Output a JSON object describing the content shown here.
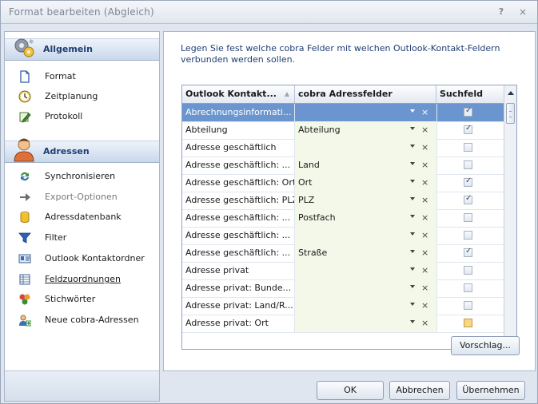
{
  "window": {
    "title": "Format bearbeiten (Abgleich)",
    "help_glyph": "?",
    "close_glyph": "×"
  },
  "sidebar": {
    "sections": [
      {
        "label": "Allgemein",
        "icon": "gears-icon",
        "items": [
          {
            "label": "Format",
            "icon": "document-icon",
            "state": "normal"
          },
          {
            "label": "Zeitplanung",
            "icon": "clock-icon",
            "state": "normal"
          },
          {
            "label": "Protokoll",
            "icon": "pencil-icon",
            "state": "normal"
          }
        ]
      },
      {
        "label": "Adressen",
        "icon": "person-icon",
        "items": [
          {
            "label": "Synchronisieren",
            "icon": "sync-icon",
            "state": "normal"
          },
          {
            "label": "Export-Optionen",
            "icon": "arrow-right-icon",
            "state": "disabled"
          },
          {
            "label": "Adressdatenbank",
            "icon": "database-icon",
            "state": "normal"
          },
          {
            "label": "Filter",
            "icon": "filter-icon",
            "state": "normal"
          },
          {
            "label": "Outlook Kontaktordner",
            "icon": "contact-card-icon",
            "state": "normal"
          },
          {
            "label": "Feldzuordnungen",
            "icon": "field-mapping-icon",
            "state": "active"
          },
          {
            "label": "Stichwörter",
            "icon": "keywords-icon",
            "state": "normal"
          },
          {
            "label": "Neue cobra-Adressen",
            "icon": "new-contacts-icon",
            "state": "normal"
          }
        ]
      }
    ]
  },
  "main": {
    "description": "Legen Sie fest welche cobra Felder mit welchen Outlook-Kontakt-Feldern verbunden werden sollen.",
    "columns": [
      "Outlook Kontakt...",
      "cobra Adressfelder",
      "Suchfeld"
    ],
    "sort_glyph": "▲",
    "remove_glyph": "×",
    "rows": [
      {
        "outlook": "Abrechnungsinformati...",
        "cobra": "",
        "search": true,
        "selected": true,
        "highlight": false
      },
      {
        "outlook": "Abteilung",
        "cobra": "Abteilung",
        "search": true,
        "selected": false,
        "highlight": false
      },
      {
        "outlook": "Adresse geschäftlich",
        "cobra": "",
        "search": false,
        "selected": false,
        "highlight": false
      },
      {
        "outlook": "Adresse geschäftlich: ...",
        "cobra": "Land",
        "search": false,
        "selected": false,
        "highlight": false
      },
      {
        "outlook": "Adresse geschäftlich: Ort",
        "cobra": "Ort",
        "search": true,
        "selected": false,
        "highlight": false
      },
      {
        "outlook": "Adresse geschäftlich: PLZ",
        "cobra": "PLZ",
        "search": true,
        "selected": false,
        "highlight": false
      },
      {
        "outlook": "Adresse geschäftlich: ...",
        "cobra": "Postfach",
        "search": false,
        "selected": false,
        "highlight": false
      },
      {
        "outlook": "Adresse geschäftlich: ...",
        "cobra": "",
        "search": false,
        "selected": false,
        "highlight": false
      },
      {
        "outlook": "Adresse geschäftlich: ...",
        "cobra": "Straße",
        "search": true,
        "selected": false,
        "highlight": false
      },
      {
        "outlook": "Adresse privat",
        "cobra": "",
        "search": false,
        "selected": false,
        "highlight": false
      },
      {
        "outlook": "Adresse privat: Bunde...",
        "cobra": "",
        "search": false,
        "selected": false,
        "highlight": false
      },
      {
        "outlook": "Adresse privat: Land/R...",
        "cobra": "",
        "search": false,
        "selected": false,
        "highlight": false
      },
      {
        "outlook": "Adresse privat: Ort",
        "cobra": "",
        "search": false,
        "selected": false,
        "highlight": true
      }
    ],
    "suggest_label": "Vorschlag..."
  },
  "footer": {
    "ok_label": "OK",
    "cancel_label": "Abbrechen",
    "apply_label": "Übernehmen"
  }
}
